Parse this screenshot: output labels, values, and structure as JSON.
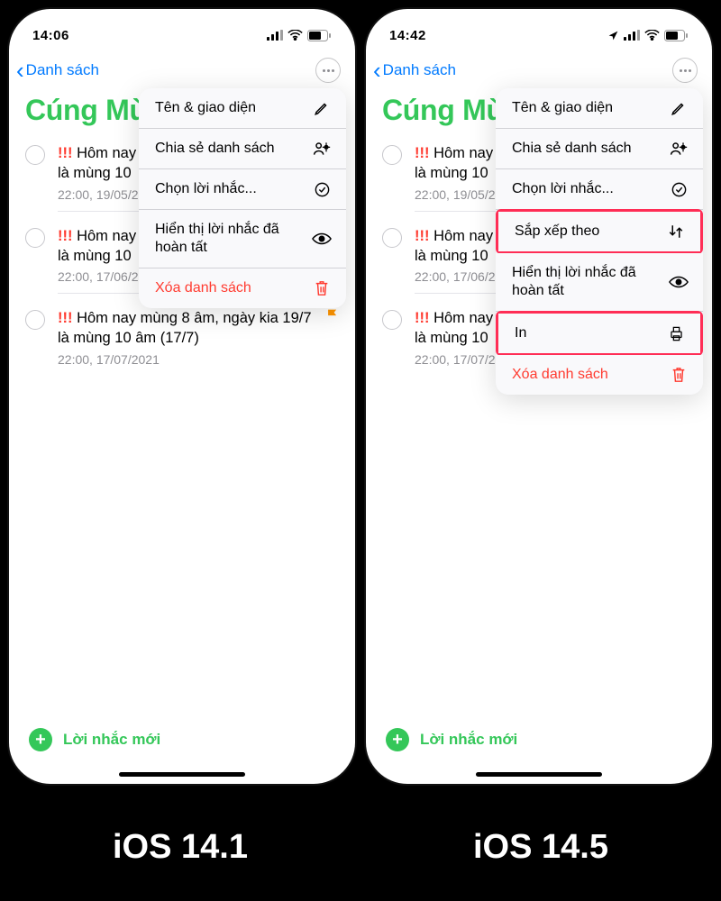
{
  "captions": {
    "left": "iOS 14.1",
    "right": "iOS 14.5"
  },
  "left": {
    "status": {
      "time": "14:06",
      "has_location": false
    },
    "nav": {
      "back": "Danh sách"
    },
    "title": "Cúng Mù",
    "reminders": [
      {
        "priority": "!!!",
        "text_a": "Hôm nay m",
        "text_b": "là mùng 10",
        "ts": "22:00, 19/05/2",
        "flagged": false
      },
      {
        "priority": "!!!",
        "text_a": "Hôm nay m",
        "text_b": "là mùng 10",
        "ts": "22:00, 17/06/2",
        "flagged": false
      },
      {
        "priority": "!!!",
        "text_a": "Hôm nay mùng 8 âm, ngày kia 19/7",
        "text_b": "là mùng 10 âm (17/7)",
        "ts": "22:00, 17/07/2021",
        "flagged": true
      }
    ],
    "menu": [
      {
        "label": "Tên & giao diện",
        "icon": "pencil",
        "highlight": false
      },
      {
        "label": "Chia sẻ danh sách",
        "icon": "share-person",
        "highlight": false
      },
      {
        "label": "Chọn lời nhắc...",
        "icon": "check-circle",
        "highlight": false
      },
      {
        "label": "Hiển thị lời nhắc đã hoàn tất",
        "icon": "eye",
        "highlight": false
      },
      {
        "label": "Xóa danh sách",
        "icon": "trash",
        "red": true,
        "highlight": false
      }
    ],
    "new_reminder": "Lời nhắc mới"
  },
  "right": {
    "status": {
      "time": "14:42",
      "has_location": true
    },
    "nav": {
      "back": "Danh sách"
    },
    "title": "Cúng Mù",
    "reminders": [
      {
        "priority": "!!!",
        "text_a": "Hôm nay m",
        "text_b": "là mùng 10",
        "ts": "22:00, 19/05/2",
        "flagged": false
      },
      {
        "priority": "!!!",
        "text_a": "Hôm nay m",
        "text_b": "là mùng 10",
        "ts": "22:00, 17/06/2",
        "flagged": false
      },
      {
        "priority": "!!!",
        "text_a": "Hôm nay m",
        "text_b": "là mùng 10",
        "ts": "22:00, 17/07/2",
        "flagged": false
      }
    ],
    "menu": [
      {
        "label": "Tên & giao diện",
        "icon": "pencil",
        "highlight": false
      },
      {
        "label": "Chia sẻ danh sách",
        "icon": "share-person",
        "highlight": false
      },
      {
        "label": "Chọn lời nhắc...",
        "icon": "check-circle",
        "highlight": false
      },
      {
        "label": "Sắp xếp theo",
        "icon": "sort",
        "highlight": true
      },
      {
        "label": "Hiển thị lời nhắc đã hoàn tất",
        "icon": "eye",
        "highlight": false
      },
      {
        "label": "In",
        "icon": "printer",
        "highlight": true
      },
      {
        "label": "Xóa danh sách",
        "icon": "trash",
        "red": true,
        "highlight": false
      }
    ],
    "new_reminder": "Lời nhắc mới"
  }
}
